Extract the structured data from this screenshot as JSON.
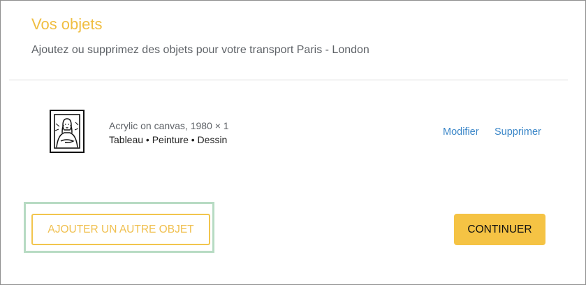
{
  "header": {
    "title": "Vos objets",
    "subtitle": "Ajoutez ou supprimez des objets pour votre transport Paris - London"
  },
  "items": [
    {
      "icon": "painting-icon",
      "description": "Acrylic on canvas, 1980 × 1",
      "categories": "Tableau • Peinture • Dessin",
      "edit_label": "Modifier",
      "delete_label": "Supprimer"
    }
  ],
  "actions": {
    "add_label": "AJOUTER UN AUTRE OBJET",
    "continue_label": "CONTINUER"
  },
  "colors": {
    "accent": "#f0be41",
    "link": "#3a86c8",
    "highlight": "#b7dbc3",
    "primary_button": "#f5c344"
  }
}
